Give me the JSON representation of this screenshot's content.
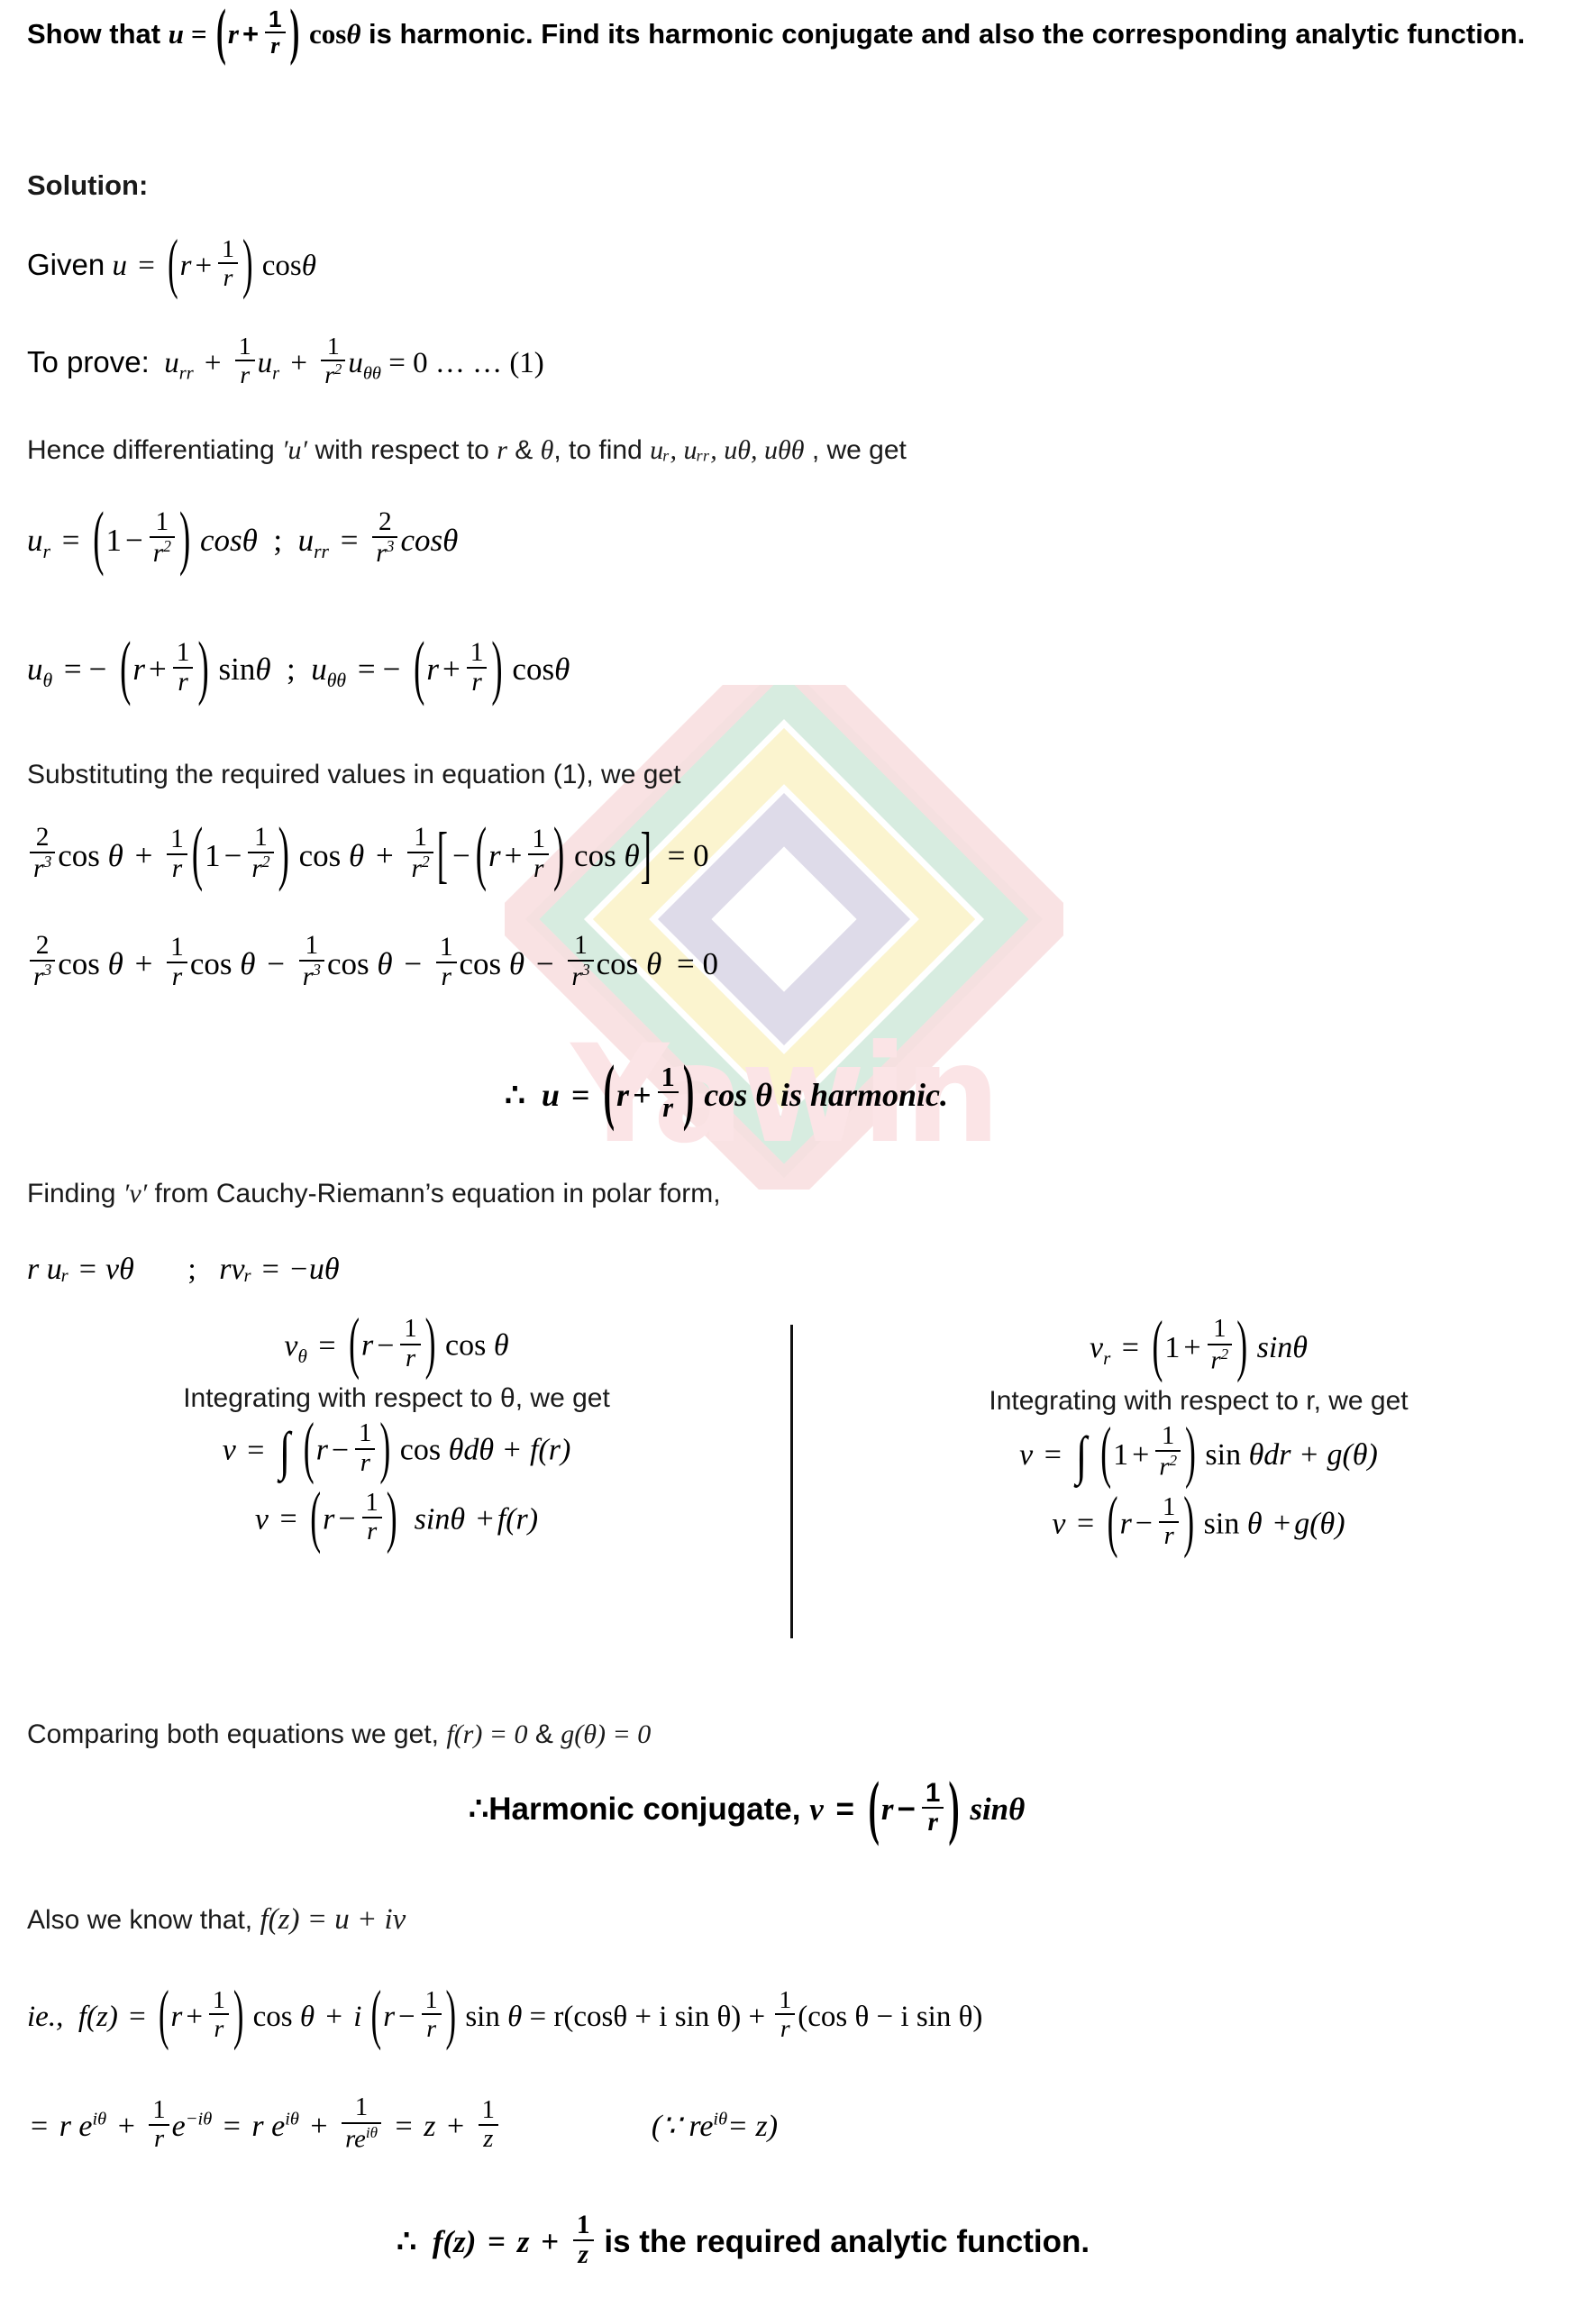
{
  "document": {
    "type": "math-solution-worksheet",
    "subject": "Complex Analysis — Harmonic Functions",
    "watermark": {
      "brand_text": "Yawin",
      "logo_name": "yawin-diamond-logo",
      "colors": {
        "green": "#d7ece0",
        "yellow": "#fbf4cf",
        "purple": "#dedbe9",
        "pink": "#f8dfe0",
        "text": "#fbe4e6"
      }
    }
  },
  "question": {
    "prefix": "Show that",
    "expr_u": "u =",
    "paren_open": "(",
    "r": "r",
    "plus": "+",
    "frac_num": "1",
    "frac_den": "r",
    "paren_close": ")",
    "cos": "cos",
    "theta": "θ",
    "line1_tail": "is harmonic. Find its harmonic conjugate and also the corresponding",
    "line2": "analytic function."
  },
  "solution_heading": "Solution:",
  "given": {
    "label": "Given",
    "u": "u",
    "eq": "=",
    "cos": "cos",
    "theta": "θ"
  },
  "to_prove": {
    "label": "To prove:",
    "u_rr": "u",
    "sub_rr": "rr",
    "u_r": "u",
    "sub_r": "r",
    "u_tt": "u",
    "sub_tt": "θθ",
    "one": "1",
    "r": "r",
    "r2": "r",
    "sup2": "2",
    "rhs": "= 0 … … (1)"
  },
  "hence_line": {
    "a": "Hence differentiating",
    "quoted_u": "′u′",
    "b": "with respect to",
    "r": "r",
    "amp": "&",
    "theta": "θ",
    "c": ", to find",
    "list": "uᵣ, uᵣᵣ, uθ, uθθ",
    "d": ", we get"
  },
  "derivatives": {
    "ur_lhs": "u",
    "ur_sub": "r",
    "one": "1",
    "r2": "r",
    "sup2": "2",
    "cos_it": "cosθ",
    "semicolon": ";",
    "urr_lhs": "u",
    "urr_sub": "rr",
    "two": "2",
    "r3": "r",
    "sup3": "3",
    "utheta_lhs": "u",
    "utheta_sub": "θ",
    "sin": "sin",
    "theta": "θ",
    "uthetatheta_lhs": "u",
    "uthetatheta_sub": "θθ",
    "cos": "cos",
    "r": "r"
  },
  "substituting_line": "Substituting the required values in equation (1), we get",
  "subst_eq1": {
    "two": "2",
    "r3": "r",
    "sup3": "3",
    "cos": "cos",
    "theta": "θ",
    "one": "1",
    "r": "r",
    "sup2": "2",
    "equals_zero": "= 0"
  },
  "subst_eq2": {
    "two": "2",
    "one": "1",
    "r": "r",
    "sup3": "3",
    "cos": "cos",
    "theta": "θ",
    "equals_zero": "= 0"
  },
  "harmonic_conclusion": {
    "therefore": "∴",
    "u": "u",
    "eq": "=",
    "r": "r",
    "plus": "+",
    "one": "1",
    "cos": "cos",
    "theta": "θ",
    "tail": "is harmonic."
  },
  "finding_v_line": {
    "a": "Finding",
    "quoted_v": "′v′",
    "b": "from Cauchy-Riemann’s equation in polar form,"
  },
  "cr_equations": {
    "left": "r uᵣ = vθ",
    "semicolon": ";",
    "right": "rvᵣ = −uθ"
  },
  "two_column": {
    "left": {
      "eq_top_lhs": "v",
      "eq_top_sub": "θ",
      "eq_top_eq": "=",
      "r": "r",
      "minus": "−",
      "one": "1",
      "cos": "cos",
      "theta": "θ",
      "lead": "Integrating with respect to θ, we get",
      "v": "v",
      "eq": "=",
      "integral": "∫",
      "dtheta": "dθ",
      "plus_fr": "+ f(r)",
      "sin_it": "sinθ",
      "fr": "f(r)"
    },
    "right": {
      "eq_top_lhs": "v",
      "eq_top_sub": "r",
      "eq_top_eq": "=",
      "one_num": "1",
      "plus": "+",
      "r2": "r",
      "sup2": "2",
      "sin_it": "sinθ",
      "lead": "Integrating with respect to r, we get",
      "v": "v",
      "eq": "=",
      "integral": "∫",
      "sin": "sin",
      "theta": "θ",
      "dr": "dr",
      "plus_gtheta": "+ g(θ)",
      "r": "r",
      "minus": "−",
      "gtheta": "g(θ)"
    }
  },
  "comparing_line": {
    "a": "Comparing both equations we get,",
    "fr": "f(r) = 0",
    "amp": "&",
    "gtheta": "g(θ) = 0"
  },
  "harmonic_conjugate": {
    "therefore": "∴",
    "label": "Harmonic conjugate,",
    "v": "v",
    "eq": "=",
    "r": "r",
    "minus": "−",
    "one": "1",
    "sin_it": "sinθ"
  },
  "also_line": {
    "a": "Also we know that,",
    "fz": "f(z) = u + iv"
  },
  "fz_expansion": {
    "ie": "ie.,",
    "fz": "f(z)",
    "eq": "=",
    "r": "r",
    "plus": "+",
    "minus": "−",
    "one": "1",
    "cos": "cos",
    "sin": "sin",
    "theta": "θ",
    "i": "i",
    "mid": "= r(cosθ + i sin θ) +",
    "tail": "(cos θ − i sin θ)"
  },
  "euler_line": {
    "start": "=",
    "r": "r",
    "e": "e",
    "itheta": "iθ",
    "minus_itheta": "−iθ",
    "plus": "+",
    "one": "1",
    "reitheta": "re",
    "z": "z",
    "note": "(∵ re",
    "note_tail": "= z)"
  },
  "final_conclusion": {
    "therefore": "∴",
    "fz": "f(z)",
    "eq": "=",
    "z": "z",
    "plus": "+",
    "one": "1",
    "tail": "is the required analytic function."
  }
}
